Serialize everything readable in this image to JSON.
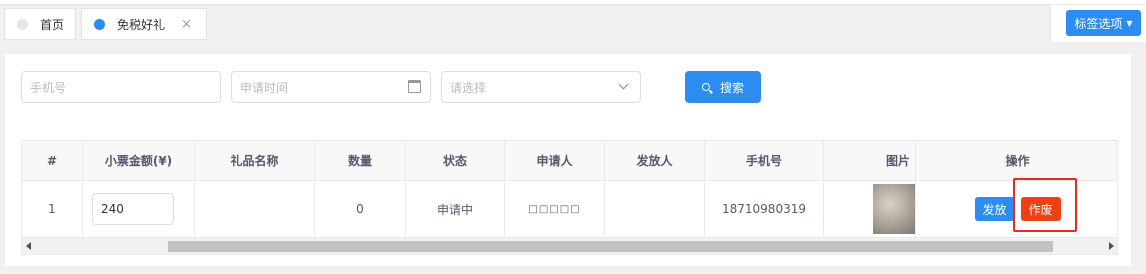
{
  "tabs": {
    "home": "首页",
    "gift": "免税好礼",
    "close": "×"
  },
  "tag_options": "标签选项",
  "filters": {
    "phone_placeholder": "手机号",
    "date_placeholder": "申请时间",
    "select_placeholder": "请选择",
    "search_label": "搜索"
  },
  "table": {
    "headers": [
      "#",
      "小票金额(¥)",
      "礼品名称",
      "数量",
      "状态",
      "申请人",
      "发放人",
      "手机号",
      "图片",
      "操作"
    ],
    "rows": [
      {
        "index": "1",
        "amount": "240",
        "gift_name": "",
        "quantity": "0",
        "status": "申请中",
        "applicant": "□□□□□",
        "issuer": "",
        "phone": "18710980319",
        "actions": {
          "issue": "发放",
          "void": "作废"
        }
      }
    ]
  },
  "colors": {
    "primary": "#2d8cf0",
    "danger": "#ed4014",
    "highlight_box": "#e82a21"
  }
}
